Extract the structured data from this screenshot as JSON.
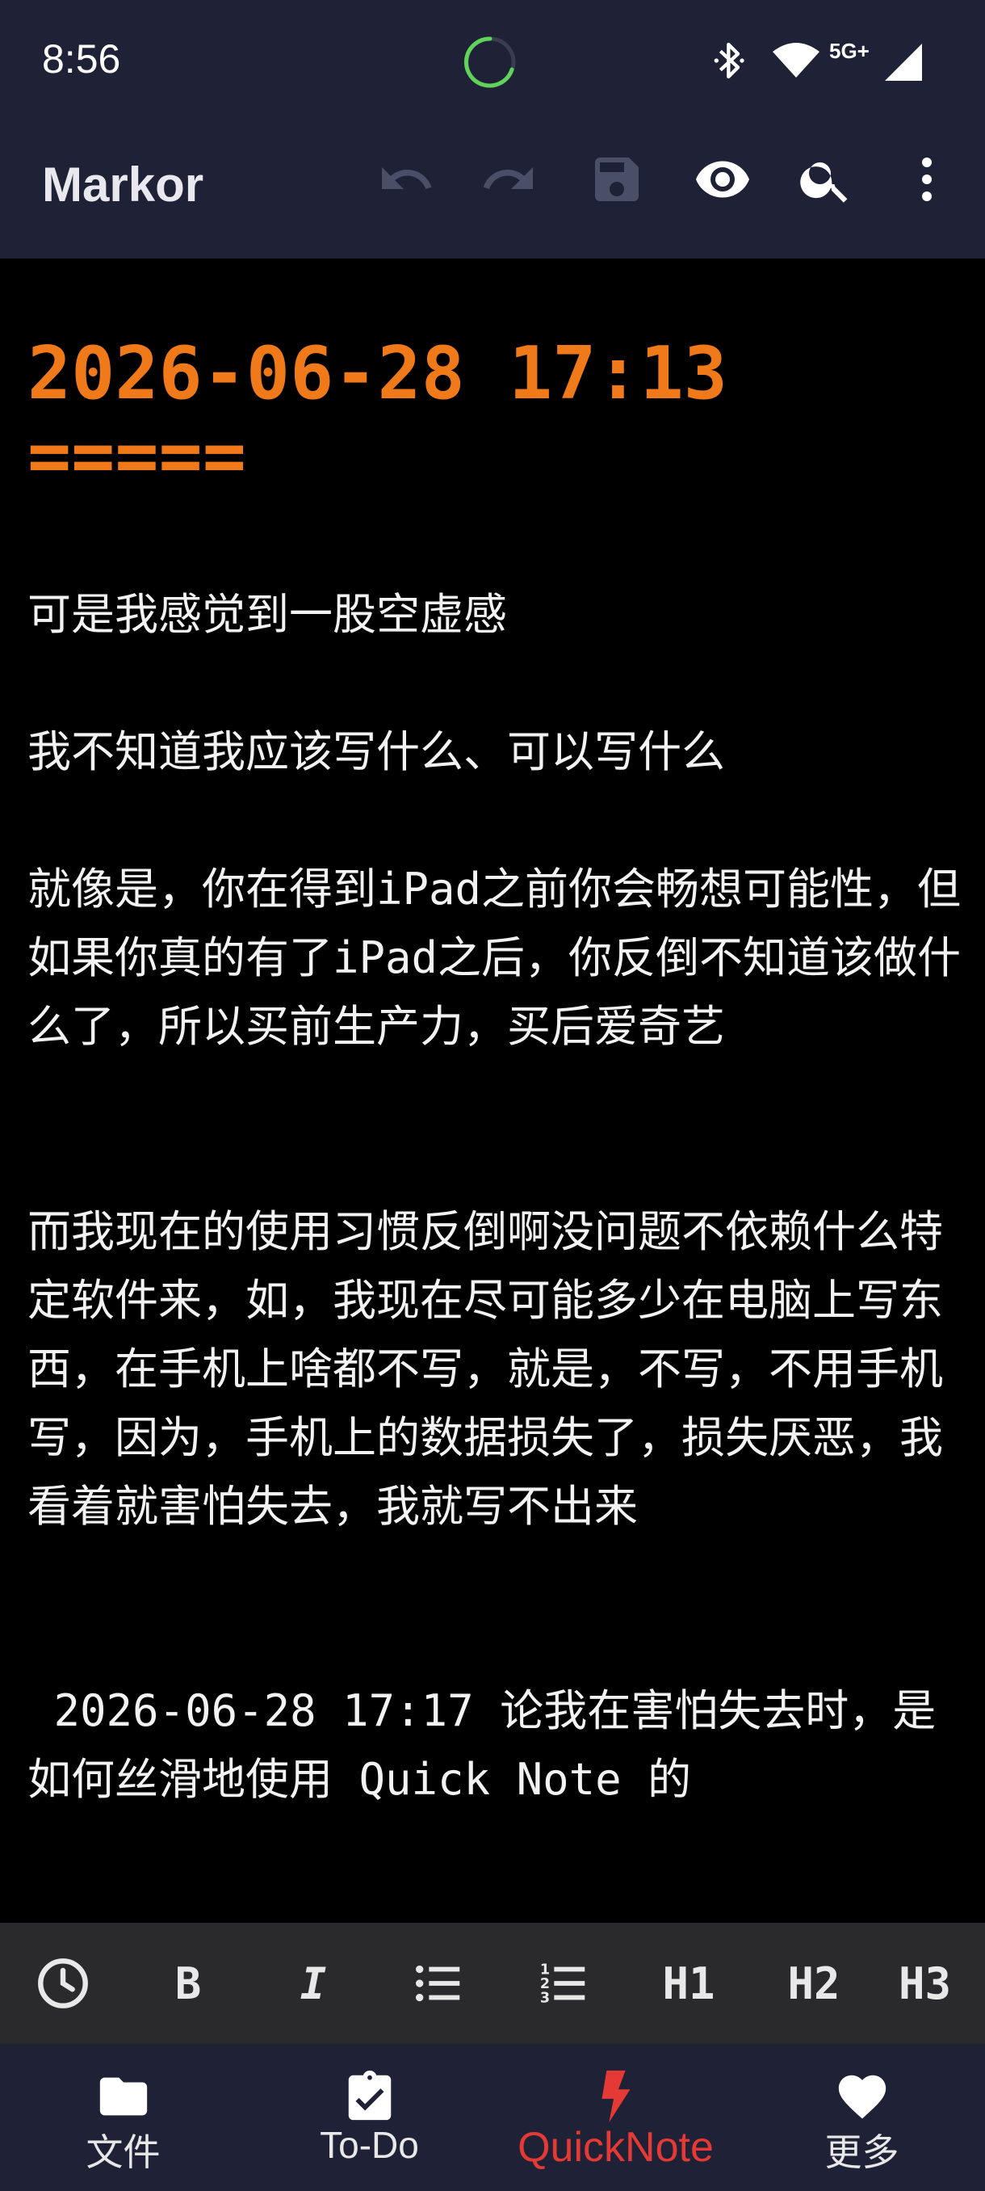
{
  "status_bar": {
    "time": "8:56",
    "network_label": "5G+",
    "icons": [
      "loading-spinner-icon",
      "bluetooth-icon",
      "wifi-icon",
      "cell-signal-icon"
    ]
  },
  "toolbar": {
    "title": "Markor",
    "actions": [
      "undo-icon",
      "redo-icon",
      "save-icon",
      "preview-eye-icon",
      "search-icon",
      "more-vert-icon"
    ]
  },
  "editor": {
    "heading": "2026-06-28 17:13",
    "heading_underline": "=====",
    "paragraphs": [
      "可是我感觉到一股空虚感",
      "我不知道我应该写什么、可以写什么",
      "就像是，你在得到iPad之前你会畅想可能性，但如果你真的有了iPad之后，你反倒不知道该做什么了，所以买前生产力，买后爱奇艺",
      "而我现在的使用习惯反倒啊没问题不依赖什么特定软件来，如，我现在尽可能多少在电脑上写东西，在手机上啥都不写，就是，不写，不用手机写，因为，手机上的数据损失了，损失厌恶，我看着就害怕失去，我就写不出来",
      " 2026-06-28 17:17 论我在害怕失去时，是如何丝滑地使用 Quick Note 的"
    ]
  },
  "format_bar": {
    "items": [
      {
        "icon": "clock-icon"
      },
      {
        "label": "B"
      },
      {
        "label": "I"
      },
      {
        "icon": "bulleted-list-icon"
      },
      {
        "icon": "numbered-list-icon"
      },
      {
        "label": "H1"
      },
      {
        "label": "H2"
      },
      {
        "label": "H3"
      }
    ]
  },
  "bottom_nav": {
    "items": [
      {
        "label": "文件",
        "icon": "folder-icon"
      },
      {
        "label": "To-Do",
        "icon": "clipboard-check-icon"
      },
      {
        "label": "QuickNote",
        "icon": "lightning-icon",
        "active": true
      },
      {
        "label": "更多",
        "icon": "heart-icon"
      }
    ]
  },
  "colors": {
    "bar_bg": "#1f2236",
    "heading": "#f07a1a",
    "active_tab": "#e53935",
    "spinner": "#5fd35a"
  }
}
